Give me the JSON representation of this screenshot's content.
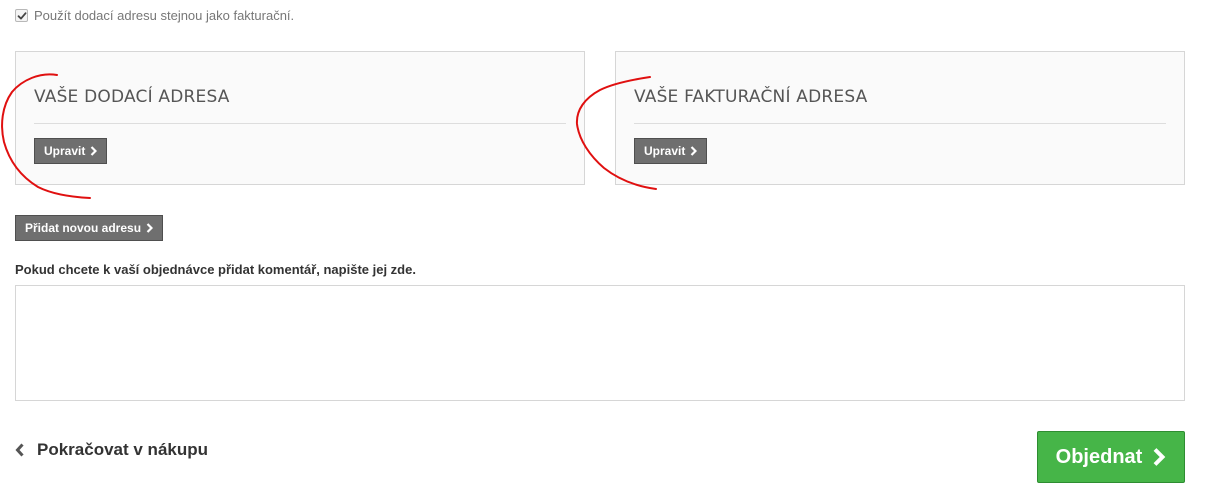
{
  "shipping_checkbox": {
    "checked": true,
    "label": "Použít dodací adresu stejnou jako fakturační."
  },
  "delivery_address": {
    "title": "VAŠE DODACÍ ADRESA",
    "edit_label": "Upravit"
  },
  "invoice_address": {
    "title": "VAŠE FAKTURAČNÍ ADRESA",
    "edit_label": "Upravit"
  },
  "add_address": {
    "label": "Přidat novou adresu"
  },
  "comment": {
    "label": "Pokud chcete k vaší objednávce přidat komentář, napište jej zde.",
    "value": ""
  },
  "footer": {
    "continue_label": "Pokračovat v nákupu",
    "order_label": "Objednat"
  },
  "icons": {
    "checkbox_check": "check-icon",
    "button_chevron": "chevron-right-icon",
    "continue_chevron": "chevron-left-icon"
  },
  "colors": {
    "dark_button": "#6f6f6f",
    "order_button": "#46b548",
    "annotation": "#e01010",
    "box_background": "#fafafa"
  }
}
